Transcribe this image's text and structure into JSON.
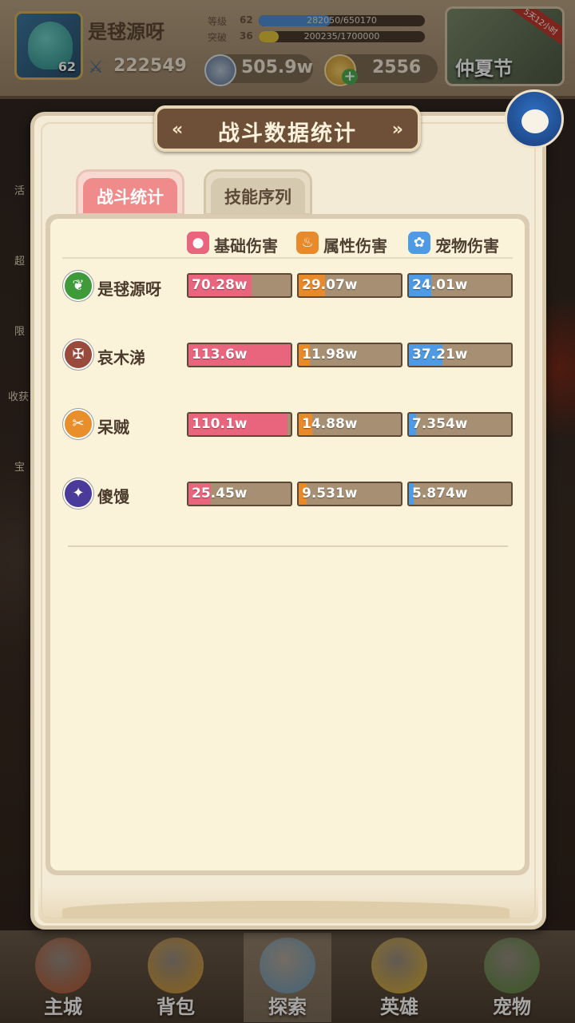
{
  "player": {
    "name": "是毬源呀",
    "level": "62",
    "power": "222549",
    "rank_label": "等级",
    "rank_value": "62",
    "rank_progress_text": "282050/650170",
    "rank_progress": 0.434,
    "break_label": "突破",
    "break_value": "36",
    "break_progress_text": "200235/1700000",
    "break_progress": 0.118
  },
  "currency": {
    "silver": "505.9w",
    "gold": "2556"
  },
  "event": {
    "name": "仲夏节",
    "tag": "5天12小时"
  },
  "dialog": {
    "title": "战斗数据统计",
    "tabs": [
      {
        "label": "战斗统计",
        "active": true
      },
      {
        "label": "技能序列",
        "active": false
      }
    ],
    "columns": [
      {
        "label": "基础伤害",
        "icon": "person-icon",
        "color": "#e9657d"
      },
      {
        "label": "属性伤害",
        "icon": "fire-icon",
        "color": "#e8892a"
      },
      {
        "label": "宠物伤害",
        "icon": "paw-icon",
        "color": "#4f9ae4"
      }
    ],
    "rows": [
      {
        "name": "是毬源呀",
        "icon_color": "#3f9a3a",
        "icon": "leaf-icon",
        "values": [
          "70.28w",
          "29.07w",
          "24.01w"
        ],
        "fractions": [
          0.62,
          0.26,
          0.22
        ]
      },
      {
        "name": "哀木涕",
        "icon_color": "#9a4a3a",
        "icon": "shield-icon",
        "values": [
          "113.6w",
          "11.98w",
          "37.21w"
        ],
        "fractions": [
          1.0,
          0.11,
          0.33
        ]
      },
      {
        "name": "呆贼",
        "icon_color": "#e88e2a",
        "icon": "dagger-icon",
        "values": [
          "110.1w",
          "14.88w",
          "7.354w"
        ],
        "fractions": [
          0.97,
          0.13,
          0.07
        ]
      },
      {
        "name": "傻馒",
        "icon_color": "#4a3a9a",
        "icon": "rune-icon",
        "values": [
          "25.45w",
          "9.531w",
          "5.874w"
        ],
        "fractions": [
          0.22,
          0.08,
          0.05
        ]
      }
    ]
  },
  "side_labels": [
    "活",
    "超",
    "限",
    "收获",
    "宝"
  ],
  "nav": [
    {
      "label": "主城",
      "active": false,
      "color": "#b8562e"
    },
    {
      "label": "背包",
      "active": false,
      "color": "#d99a2a"
    },
    {
      "label": "探索",
      "active": true,
      "color": "#6a9ab8"
    },
    {
      "label": "英雄",
      "active": false,
      "color": "#e0b030"
    },
    {
      "label": "宠物",
      "active": false,
      "color": "#5a8a3a"
    }
  ]
}
